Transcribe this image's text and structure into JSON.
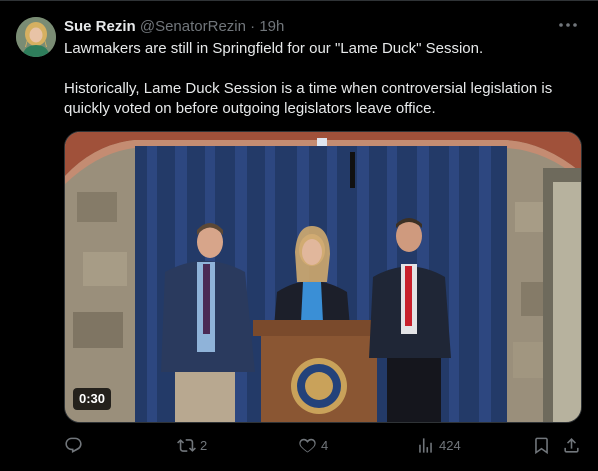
{
  "author": {
    "name": "Sue Rezin",
    "handle": "@SenatorRezin",
    "separator": "·",
    "time": "19h"
  },
  "tweet": {
    "paragraph1": "Lawmakers are still in Springfield for our \"Lame Duck\" Session.",
    "paragraph2": "Historically, Lame Duck Session is a time when controversial legislation is quickly voted on before outgoing legislators leave office."
  },
  "media": {
    "type": "video",
    "duration": "0:30"
  },
  "actions": {
    "replies": "",
    "retweets": "2",
    "likes": "4",
    "views": "424"
  },
  "icons": [
    "more-icon",
    "reply-icon",
    "retweet-icon",
    "like-icon",
    "views-icon",
    "bookmark-icon",
    "share-icon"
  ],
  "colors": {
    "background": "#000000",
    "text": "#e7e9ea",
    "muted": "#71767b",
    "border": "#2f3336"
  }
}
